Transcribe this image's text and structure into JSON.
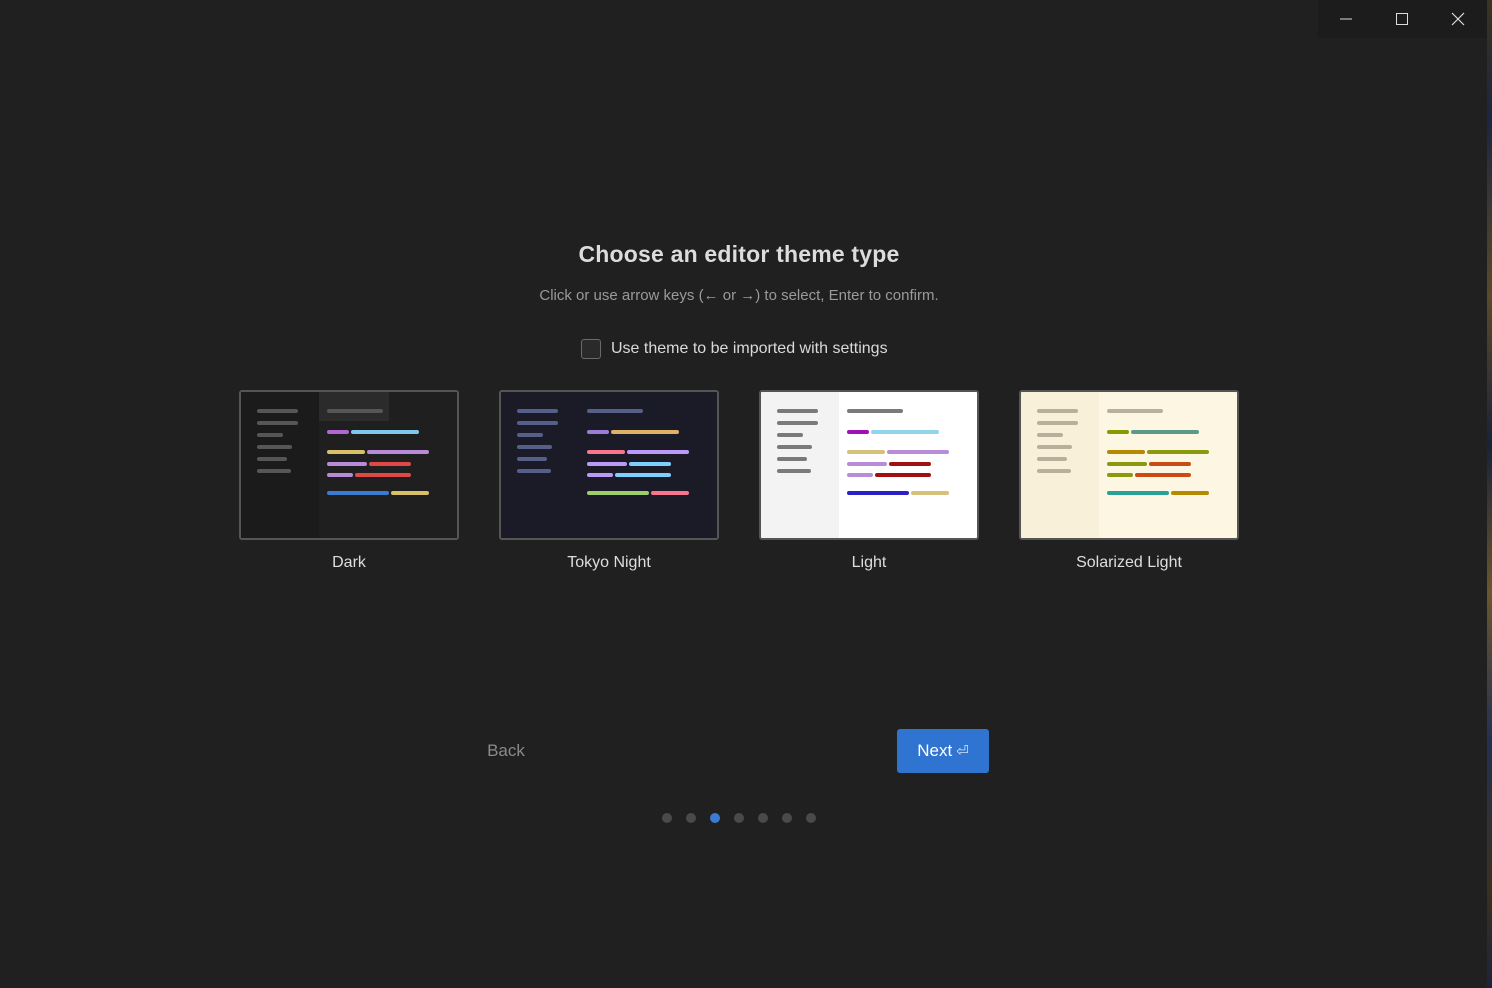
{
  "window": {
    "controls": [
      {
        "name": "minimize-icon"
      },
      {
        "name": "maximize-icon"
      },
      {
        "name": "close-icon"
      }
    ]
  },
  "heading": {
    "title": "Choose an editor theme type",
    "subtitle": "Click or use arrow keys (← or →) to select, Enter to confirm."
  },
  "import_option": {
    "label": "Use theme to be imported with settings",
    "checked": false
  },
  "themes": [
    {
      "label": "Dark",
      "colors": {
        "bg": "#1f1f1f",
        "sidebar": "#1b1b1b",
        "tab": "#2b2b2b",
        "muted": "#565656",
        "editor": "#1f1f1f",
        "c1": "#b066d4",
        "c2": "#7ec8e8",
        "c3": "#d8c06a",
        "c4": "#b98ad8",
        "c5": "#e04848",
        "c6": "#3a7ad0"
      }
    },
    {
      "label": "Tokyo Night",
      "colors": {
        "bg": "#1a1b26",
        "sidebar": "#1a1b26",
        "tab": "#1a1b26",
        "muted": "#565f89",
        "editor": "#1a1b26",
        "c1": "#9d7cd8",
        "c2": "#e0af68",
        "c3": "#f7768e",
        "c4": "#bb9af7",
        "c5": "#7dcfff",
        "c6": "#9ece6a"
      }
    },
    {
      "label": "Light",
      "colors": {
        "bg": "#f3f3f3",
        "sidebar": "#f3f3f3",
        "tab": "#ffffff",
        "muted": "#7a7a7a",
        "editor": "#ffffff",
        "c1": "#a010b8",
        "c2": "#90d4ee",
        "c3": "#d6c07a",
        "c4": "#b88cd8",
        "c5": "#a01010",
        "c6": "#2a20c8"
      }
    },
    {
      "label": "Solarized Light",
      "colors": {
        "bg": "#fdf6e3",
        "sidebar": "#f8f0d8",
        "tab": "#fdf6e3",
        "muted": "#b8b09a",
        "editor": "#fdf6e3",
        "c1": "#859900",
        "c2": "#5a9a8a",
        "c3": "#b58900",
        "c4": "#8a9a10",
        "c5": "#cb4b16",
        "c6": "#2aa198"
      }
    }
  ],
  "nav": {
    "back_label": "Back",
    "next_label": "Next",
    "next_icon": "enter-key-icon",
    "next_glyph": "⏎"
  },
  "progress": {
    "steps": 7,
    "current": 3
  },
  "accent": "#2f74d0"
}
